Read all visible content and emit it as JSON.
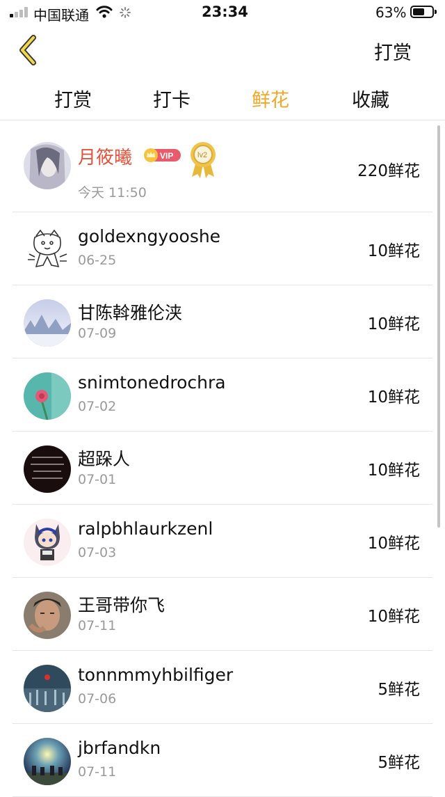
{
  "status_bar": {
    "carrier": "中国联通",
    "time": "23:34",
    "battery_percent": "63%",
    "battery_level": 0.63,
    "icons": [
      "signal-icon",
      "wifi-icon",
      "loading-icon",
      "battery-icon"
    ]
  },
  "nav": {
    "back_icon": "chevron-left-icon",
    "action_label": "打赏"
  },
  "tabs": [
    {
      "label": "打赏",
      "active": false
    },
    {
      "label": "打卡",
      "active": false
    },
    {
      "label": "鲜花",
      "active": true
    },
    {
      "label": "收藏",
      "active": false
    }
  ],
  "colors": {
    "accent": "#f5a623",
    "top_name": "#e5533d",
    "secondary_text": "#9a9a9a",
    "vip_badge": "#e95b6b"
  },
  "list": [
    {
      "name": "月筱曦",
      "date": "今天 11:50",
      "amount": "220鲜花",
      "vip_label": "VIP",
      "level_label": "lv2"
    },
    {
      "name": "goldexngyooshe",
      "date": "06-25",
      "amount": "10鲜花"
    },
    {
      "name": "甘陈斡雅伦浃",
      "date": "07-09",
      "amount": "10鲜花"
    },
    {
      "name": "snimtonedrochra",
      "date": "07-02",
      "amount": "10鲜花"
    },
    {
      "name": "超跺人",
      "date": "07-01",
      "amount": "10鲜花"
    },
    {
      "name": "ralpbhlaurkzenl",
      "date": "07-03",
      "amount": "10鲜花"
    },
    {
      "name": "王哥带你飞",
      "date": "07-11",
      "amount": "10鲜花"
    },
    {
      "name": "tonnmmyhbilfiger",
      "date": "07-06",
      "amount": "5鲜花"
    },
    {
      "name": "jbrfandkn",
      "date": "07-11",
      "amount": "5鲜花"
    }
  ]
}
